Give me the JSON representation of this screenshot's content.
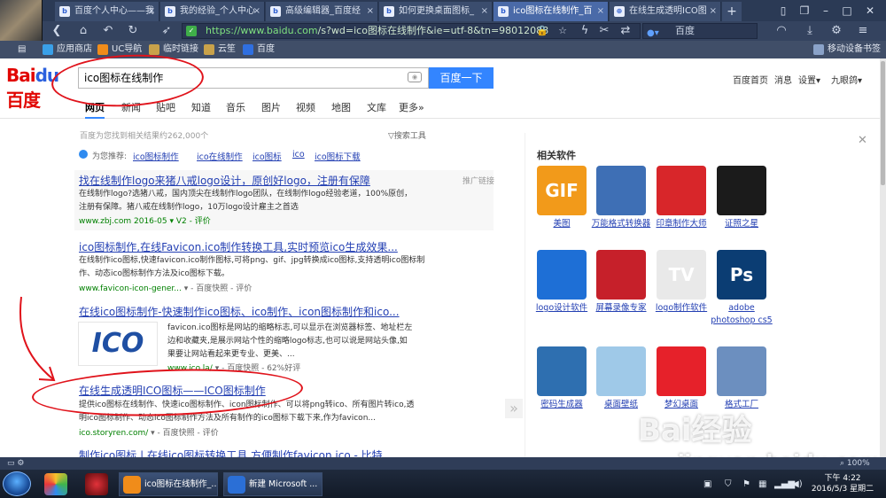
{
  "browser": {
    "tabs": [
      {
        "title": "百度个人中心——我",
        "active": false
      },
      {
        "title": "我的经验_个人中心",
        "active": false
      },
      {
        "title": "高级编辑器_百度经",
        "active": false
      },
      {
        "title": "如何更换桌面图标_",
        "active": false
      },
      {
        "title": "ico图标在线制作_百",
        "active": true
      },
      {
        "title": "在线生成透明ICO图",
        "active": false
      }
    ],
    "new_tab": "+",
    "url_host": "https://www.baidu.com",
    "url_path": "/s?wd=ico图标在线制作&ie=utf-8&tn=98012088",
    "search_engine": "百度",
    "bookmarks": [
      "应用商店",
      "UC导航",
      "临时链接",
      "云笙",
      "百度"
    ],
    "mobile_device": "移动设备书签"
  },
  "baidu": {
    "logo_text": "Bai",
    "logo_paw": "du",
    "logo_cn": "百度",
    "query": "ico图标在线制作",
    "search_button": "百度一下",
    "header_links": [
      "百度首页",
      "消息",
      "设置▾",
      "九眼鸽▾"
    ],
    "tabs": [
      "网页",
      "新闻",
      "贴吧",
      "知道",
      "音乐",
      "图片",
      "视频",
      "地图",
      "文库",
      "更多»"
    ],
    "result_count": "百度为您找到相关结果约262,000个",
    "search_tools": "搜索工具",
    "recommend_label": "为您推荐:",
    "recommend": [
      "ico图标制作",
      "ico在线制作",
      "ico图标",
      "ico",
      "ico图标下载"
    ],
    "ad_label": "推广链接",
    "results": [
      {
        "title": "找在线制作logo来猪八戒logo设计，原创好logo，注册有保障",
        "desc1": "在线制作logo?选猪八戒，国内顶尖在线制作logo团队，在线制作logo经验老道，100%原创，",
        "desc2": "注册有保障。猪八戒在线制作logo，10万logo设计雇主之首选",
        "url": "www.zbj.com  2016-05  ▾  V2  - 评价"
      },
      {
        "title": "ico图标制作,在线Favicon.ico制作转换工具,实时预览ico生成效果...",
        "desc1": "在线制作ico图标,快速favicon.ico制作图标,可将png、gif、jpg转换成ico图标,支持透明ico图标制",
        "desc2": "作、动态ico图标制作方法及ico图标下载。",
        "url": "www.favicon-icon-gener...",
        "cache": "百度快照",
        "rate": "评价"
      },
      {
        "title": "在线ico图标制作-快速制作ico图标、ico制作、icon图标制作和ico...",
        "desc1": "favicon.ico图标是网站的缩略标志,可以显示在浏览器标签、地址栏左",
        "desc2": "边和收藏夹,是展示网站个性的缩略logo标志,也可以说是网站头像,如",
        "desc3": "果要让网站看起来更专业、更美、...",
        "url": "www.ico.la/",
        "cache": "百度快照",
        "rate": "62%好评",
        "thumb_text": "ICO"
      },
      {
        "title": "在线生成透明ICO图标——ICO图标制作",
        "desc1": "提供ico图标在线制作、快速ico图标制作、icon图标制作、可以将png转ico、所有图片转ico,透",
        "desc2": "明ico图标制作、动态ico图标制作方法及所有制作的ico图标下载下来,作为favicon...",
        "url": "ico.storyren.com/",
        "cache": "百度快照",
        "rate": "评价"
      },
      {
        "title": "制作ico图标 | 在线ico图标转换工具 方便制作favicon.ico - 比特..."
      }
    ],
    "side_title": "相关软件",
    "close": "✕",
    "software": [
      {
        "name": "美图",
        "color": "#f29a1a",
        "text": "GIF"
      },
      {
        "name": "万能格式转换器",
        "color": "#3e6fb5",
        "text": ""
      },
      {
        "name": "印章制作大师",
        "color": "#d8262a",
        "text": ""
      },
      {
        "name": "证照之星",
        "color": "#1b1b1b",
        "text": ""
      },
      {
        "name": "logo设计软件",
        "color": "#1e6fd6",
        "text": ""
      },
      {
        "name": "屏幕录像专家",
        "color": "#c6202a",
        "text": ""
      },
      {
        "name": "logo制作软件",
        "color": "#e9e9e9",
        "text": "TV"
      },
      {
        "name": "adobe photoshop cs5",
        "color": "#0b3d73",
        "text": "Ps"
      },
      {
        "name": "密码生成器",
        "color": "#2e6fb0",
        "text": ""
      },
      {
        "name": "桌面壁纸",
        "color": "#9fc9e8",
        "text": ""
      },
      {
        "name": "梦幻桌面",
        "color": "#e6212a",
        "text": ""
      },
      {
        "name": "格式工厂",
        "color": "#6c8fbf",
        "text": ""
      }
    ],
    "collapse": "»"
  },
  "watermark": {
    "brand": "Bai经验",
    "url": "jingyan.baidu.com"
  },
  "status": {
    "zoom": "100%"
  },
  "taskbar": {
    "windows": [
      "ico图标在线制作_...",
      "新建 Microsoft ..."
    ],
    "time": "下午 4:22",
    "date": "2016/5/3 星期二"
  }
}
